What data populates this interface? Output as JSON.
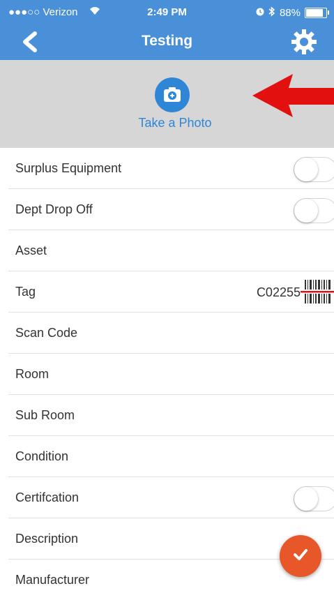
{
  "status_bar": {
    "carrier": "●●●○○ Verizon",
    "time": "2:49 PM",
    "battery": "88%",
    "battery_level": 0.88
  },
  "nav": {
    "title": "Testing"
  },
  "photo": {
    "label": "Take a Photo"
  },
  "colors": {
    "nav_blue": "#4a90d9",
    "link_blue": "#2f86d6",
    "fab_orange": "#e8572a",
    "arrow_red": "#e31010"
  },
  "form": {
    "surplus": {
      "label": "Surplus Equipment",
      "on": false
    },
    "dept_drop": {
      "label": "Dept Drop Off",
      "on": false
    },
    "asset": {
      "label": "Asset"
    },
    "tag": {
      "label": "Tag",
      "value": "C02255"
    },
    "scan_code": {
      "label": "Scan Code"
    },
    "room": {
      "label": "Room"
    },
    "sub_room": {
      "label": "Sub Room"
    },
    "condition": {
      "label": "Condition"
    },
    "certification": {
      "label": "Certifcation",
      "on": false
    },
    "description": {
      "label": "Description"
    },
    "manufacturer": {
      "label": "Manufacturer"
    }
  },
  "icons": {
    "back": "chevron-left-icon",
    "settings": "gear-icon",
    "camera": "camera-plus-icon",
    "barcode": "barcode-icon",
    "submit": "checkmark-icon"
  }
}
